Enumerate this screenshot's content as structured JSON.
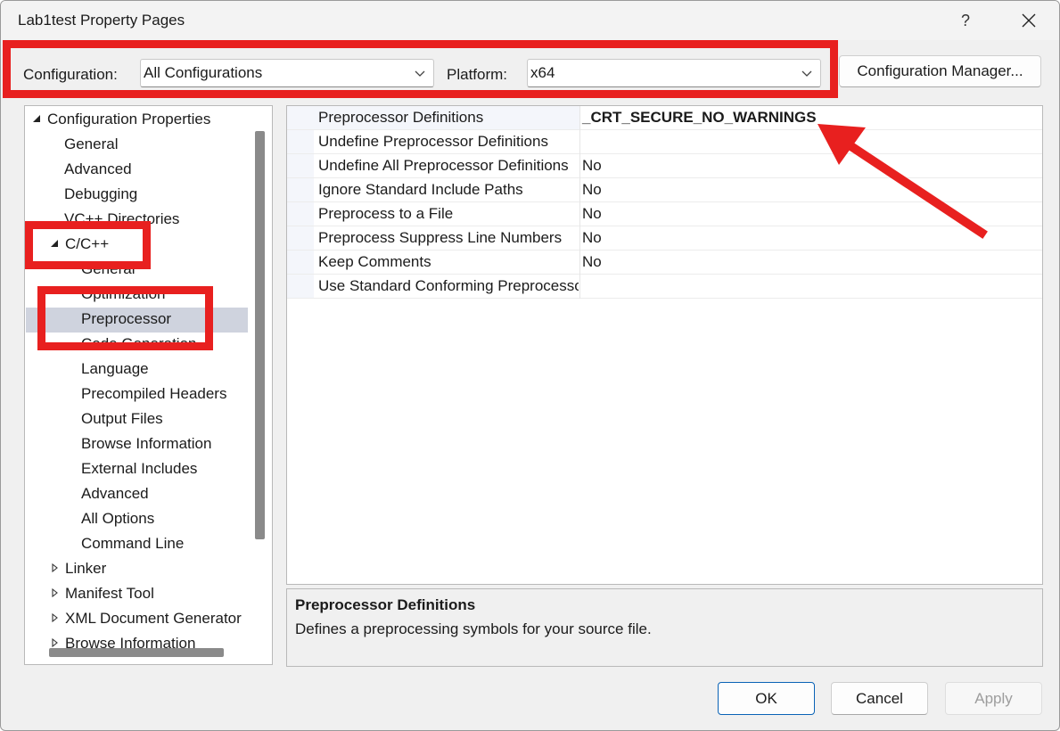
{
  "window": {
    "title": "Lab1test Property Pages",
    "help_label": "?",
    "close_icon": "close-icon"
  },
  "config": {
    "configuration_label": "Configuration:",
    "configuration_value": "All Configurations",
    "platform_label": "Platform:",
    "platform_value": "x64",
    "manager_button": "Configuration Manager..."
  },
  "tree": {
    "items": [
      {
        "label": "Configuration Properties",
        "expander": "expanded"
      },
      {
        "label": "General"
      },
      {
        "label": "Advanced"
      },
      {
        "label": "Debugging"
      },
      {
        "label": "VC++ Directories"
      },
      {
        "label": "C/C++",
        "expander": "expanded"
      },
      {
        "label": "General"
      },
      {
        "label": "Optimization"
      },
      {
        "label": "Preprocessor",
        "selected": true
      },
      {
        "label": "Code Generation"
      },
      {
        "label": "Language"
      },
      {
        "label": "Precompiled Headers"
      },
      {
        "label": "Output Files"
      },
      {
        "label": "Browse Information"
      },
      {
        "label": "External Includes"
      },
      {
        "label": "Advanced"
      },
      {
        "label": "All Options"
      },
      {
        "label": "Command Line"
      },
      {
        "label": "Linker",
        "expander": "collapsed"
      },
      {
        "label": "Manifest Tool",
        "expander": "collapsed"
      },
      {
        "label": "XML Document Generator",
        "expander": "collapsed"
      },
      {
        "label": "Browse Information",
        "expander": "collapsed"
      }
    ]
  },
  "properties": {
    "rows": [
      {
        "name": "Preprocessor Definitions",
        "value": "_CRT_SECURE_NO_WARNINGS"
      },
      {
        "name": "Undefine Preprocessor Definitions",
        "value": ""
      },
      {
        "name": "Undefine All Preprocessor Definitions",
        "value": "No"
      },
      {
        "name": "Ignore Standard Include Paths",
        "value": "No"
      },
      {
        "name": "Preprocess to a File",
        "value": "No"
      },
      {
        "name": "Preprocess Suppress Line Numbers",
        "value": "No"
      },
      {
        "name": "Keep Comments",
        "value": "No"
      },
      {
        "name": "Use Standard Conforming Preprocessor",
        "value": ""
      }
    ]
  },
  "description": {
    "title": "Preprocessor Definitions",
    "text": "Defines a preprocessing symbols for your source file."
  },
  "buttons": {
    "ok": "OK",
    "cancel": "Cancel",
    "apply": "Apply"
  },
  "colors": {
    "annotation_red": "#e8201f",
    "selection": "#cfd3de",
    "accent_border": "#0a63b6"
  }
}
